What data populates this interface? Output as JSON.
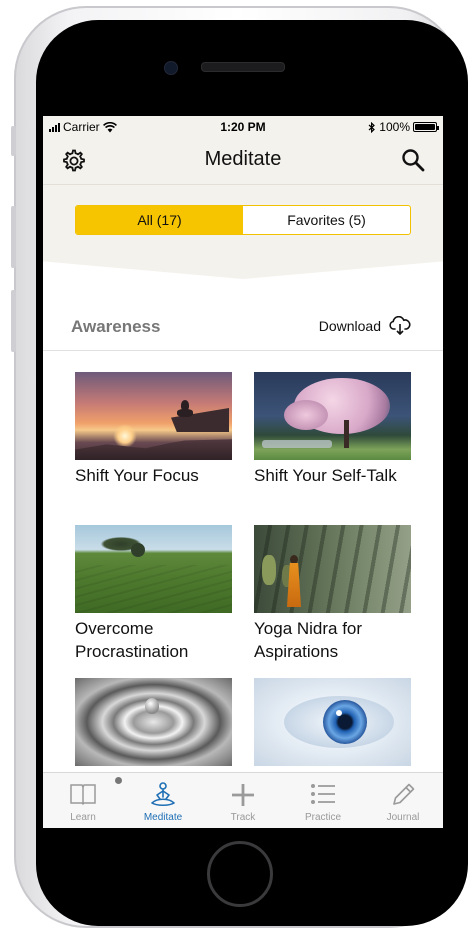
{
  "status": {
    "carrier": "Carrier",
    "time": "1:20 PM",
    "battery": "100%"
  },
  "header": {
    "title": "Meditate"
  },
  "segments": [
    {
      "label": "All (17)",
      "active": true
    },
    {
      "label": "Favorites (5)",
      "active": false
    }
  ],
  "section": {
    "title": "Awareness",
    "download_label": "Download"
  },
  "cards": [
    {
      "title": "Shift Your Focus"
    },
    {
      "title": "Shift Your Self-Talk"
    },
    {
      "title": "Overcome Procrastination"
    },
    {
      "title": "Yoga Nidra for Aspirations"
    }
  ],
  "tabs": [
    {
      "label": "Learn",
      "icon": "book-icon"
    },
    {
      "label": "Meditate",
      "icon": "meditation-icon"
    },
    {
      "label": "Track",
      "icon": "plus-icon"
    },
    {
      "label": "Practice",
      "icon": "list-icon"
    },
    {
      "label": "Journal",
      "icon": "pencil-icon"
    }
  ],
  "colors": {
    "accent": "#f7c500",
    "active_tab": "#1f6fb5",
    "header_bg": "#f4f2ec"
  }
}
